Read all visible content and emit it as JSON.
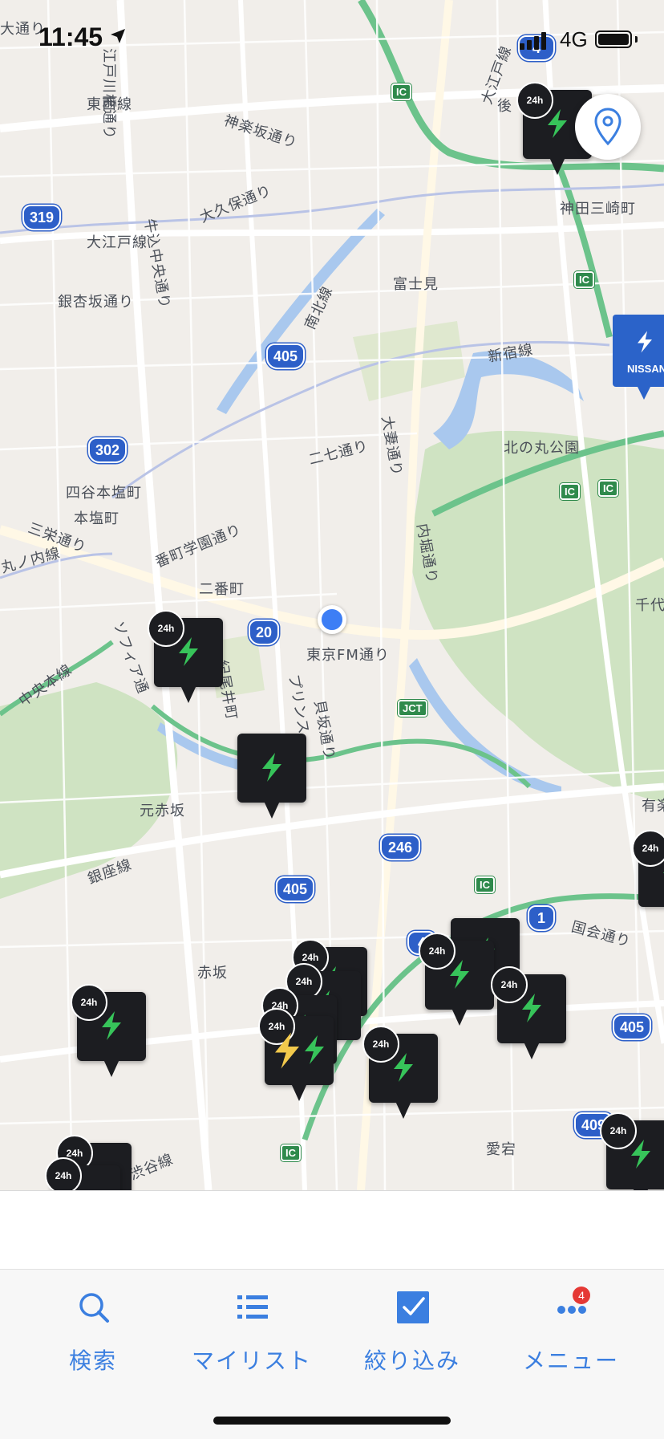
{
  "status_bar": {
    "time": "11:45",
    "network": "4G"
  },
  "map": {
    "place_labels": [
      {
        "id": "p1",
        "text": "大通り"
      },
      {
        "id": "p2",
        "text": "江戸川橋通り"
      },
      {
        "id": "p3",
        "text": "東西線"
      },
      {
        "id": "p4",
        "text": "神楽坂通り"
      },
      {
        "id": "p5",
        "text": "大久保通り"
      },
      {
        "id": "p6",
        "text": "大江戸線"
      },
      {
        "id": "p7",
        "text": "牛込中央通り"
      },
      {
        "id": "p8",
        "text": "銀杏坂通り"
      },
      {
        "id": "p9",
        "text": "富士見"
      },
      {
        "id": "p10",
        "text": "南北線"
      },
      {
        "id": "p11",
        "text": "新宿線"
      },
      {
        "id": "p12",
        "text": "大江戸線"
      },
      {
        "id": "p13",
        "text": "後"
      },
      {
        "id": "p14",
        "text": "神田三崎町"
      },
      {
        "id": "p15",
        "text": "東京FM通り"
      },
      {
        "id": "p16",
        "text": "北の丸公園"
      },
      {
        "id": "p17",
        "text": "二七通り"
      },
      {
        "id": "p18",
        "text": "大妻通り"
      },
      {
        "id": "p19",
        "text": "内堀通り"
      },
      {
        "id": "p20",
        "text": "四谷本塩町"
      },
      {
        "id": "p21",
        "text": "本塩町"
      },
      {
        "id": "p22",
        "text": "三栄通り"
      },
      {
        "id": "p23",
        "text": "丸ノ内線"
      },
      {
        "id": "p24",
        "text": "番町学園通り"
      },
      {
        "id": "p25",
        "text": "二番町"
      },
      {
        "id": "p26",
        "text": "千代"
      },
      {
        "id": "p27",
        "text": "ソフィア通"
      },
      {
        "id": "p28",
        "text": "紀尾井町"
      },
      {
        "id": "p29",
        "text": "プリンス"
      },
      {
        "id": "p30",
        "text": "貝坂通り"
      },
      {
        "id": "p31",
        "text": "中央本線"
      },
      {
        "id": "p32",
        "text": "元赤坂"
      },
      {
        "id": "p33",
        "text": "銀座線"
      },
      {
        "id": "p34",
        "text": "有楽"
      },
      {
        "id": "p35",
        "text": "国会通り"
      },
      {
        "id": "p36",
        "text": "赤坂"
      },
      {
        "id": "p37",
        "text": "愛宕"
      },
      {
        "id": "p38",
        "text": "渋谷線"
      },
      {
        "id": "p39",
        "text": "東西線"
      }
    ],
    "route_shields": [
      {
        "id": "r319",
        "text": "319"
      },
      {
        "id": "r405a",
        "text": "405"
      },
      {
        "id": "r302",
        "text": "302"
      },
      {
        "id": "r20",
        "text": "20"
      },
      {
        "id": "r246",
        "text": "246"
      },
      {
        "id": "r405b",
        "text": "405"
      },
      {
        "id": "r1",
        "text": "1"
      },
      {
        "id": "r405c",
        "text": "405"
      },
      {
        "id": "r4",
        "text": "4"
      },
      {
        "id": "r409",
        "text": "409"
      },
      {
        "id": "r4b",
        "text": "4"
      }
    ],
    "interchange_label": "IC",
    "junction_label": "JCT",
    "marker_badge": "24h",
    "nissan_label": "NISSAN",
    "colors": {
      "water": "#a9c8ee",
      "park": "#cfe3c2",
      "highway": "#6cc38b",
      "marker": "#1c1d21",
      "bolt": "#37c45a",
      "accent": "#3b7fe0"
    }
  },
  "tab_bar": {
    "items": [
      {
        "label": "検索",
        "icon": "search-icon"
      },
      {
        "label": "マイリスト",
        "icon": "list-icon"
      },
      {
        "label": "絞り込み",
        "icon": "filter-checkbox-icon"
      },
      {
        "label": "メニュー",
        "icon": "more-dots-icon"
      }
    ],
    "menu_badge": "4"
  }
}
